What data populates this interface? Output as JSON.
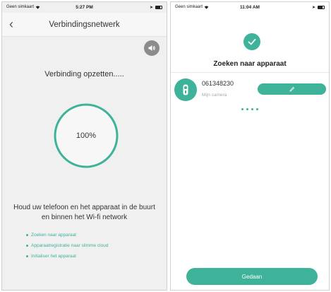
{
  "colors": {
    "accent": "#3fb29a",
    "left_background": "#f0f0f0",
    "right_background": "#ffffff"
  },
  "left_screen": {
    "status": {
      "carrier": "Geen simkaart",
      "time": "5:27 PM"
    },
    "nav": {
      "title": "Verbindingsnetwerk",
      "back_icon": "chevron-left-icon"
    },
    "sound_icon": "speaker-icon",
    "connecting_title": "Verbinding opzetten.....",
    "progress": {
      "label": "100%",
      "value": 100
    },
    "instruction": "Houd uw telefoon en het apparaat in de buurt en binnen het Wi-fi network",
    "steps": [
      "Zoeken naar apparaat",
      "Apparaatregistratie naar slimme cloud",
      "Initialiser het apparaat"
    ]
  },
  "right_screen": {
    "status": {
      "carrier": "Geen simkaart",
      "time": "11:04 AM"
    },
    "check_icon": "check-icon",
    "title": "Zoeken naar apparaat",
    "device": {
      "id": "061348230",
      "subtitle": "Mijn camera",
      "icon": "camera-icon",
      "edit_icon": "pencil-icon"
    },
    "pager_dots": 4,
    "done_label": "Gedaan"
  }
}
